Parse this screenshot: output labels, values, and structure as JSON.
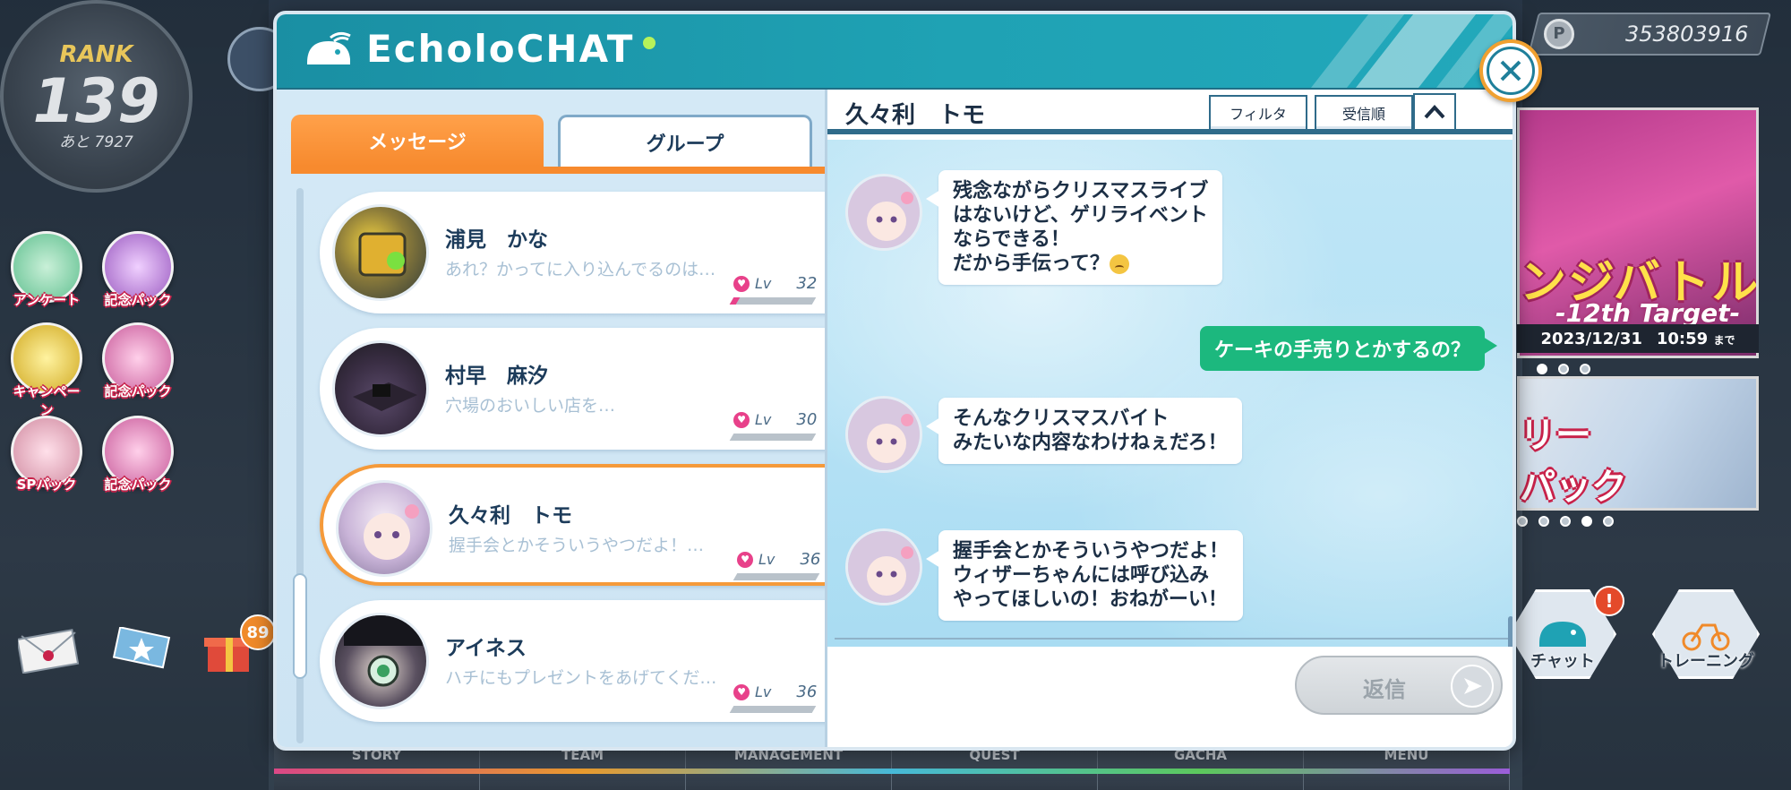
{
  "hud": {
    "rank_label": "RANK",
    "rank_value": "139",
    "rank_next": "あと 7927",
    "currency_symbol": "P",
    "currency_value": "353803916",
    "buttons": [
      {
        "label": "アンケート",
        "color": "#8fd3b0"
      },
      {
        "label": "記念パック",
        "color": "#c77dd8"
      },
      {
        "label": "キャンペーン",
        "color": "#f0d060"
      },
      {
        "label": "記念パック",
        "color": "#e07ab0"
      },
      {
        "label": "SPパック",
        "color": "#f3b0c0"
      },
      {
        "label": "記念パック",
        "color": "#e07ab0"
      }
    ],
    "gift_badge": "89",
    "banner_title": "ンジバトル",
    "banner_sub": "-12th Target-",
    "banner_date": "2023/12/31",
    "banner_time": "10:59",
    "banner_until": "まで",
    "banner2_text": "リー\nパック",
    "side_buttons": [
      {
        "label": "チャット",
        "icon": "whale-icon"
      },
      {
        "label": "トレーニング",
        "icon": "bike-icon"
      }
    ],
    "chat_alert": "!",
    "nav": [
      "STORY",
      "TEAM",
      "MANAGEMENT",
      "QUEST",
      "GACHA",
      "MENU"
    ]
  },
  "dialog": {
    "title": "EcholoCHAT",
    "close_label": "×",
    "tabs": {
      "messages": "メッセージ",
      "groups": "グループ"
    },
    "contacts": [
      {
        "name": "浦見　かな",
        "preview": "あれ？かってに入り込んでるのは…",
        "lv_label": "Lv",
        "lv": "32",
        "lv_fill": 0.05,
        "avatar_color": "#8a7a3a",
        "selected": false
      },
      {
        "name": "村早　麻汐",
        "preview": "穴場のおいしい店を…",
        "lv_label": "Lv",
        "lv": "30",
        "lv_fill": 0.0,
        "avatar_color": "#4a3a5a",
        "selected": false
      },
      {
        "name": "久々利　トモ",
        "preview": "握手会とかそういうやつだよ！…",
        "lv_label": "Lv",
        "lv": "36",
        "lv_fill": 0.0,
        "avatar_color": "#c9b4d8",
        "selected": true
      },
      {
        "name": "アイネス",
        "preview": "ハチにもプレゼントをあげてくだ…",
        "lv_label": "Lv",
        "lv": "36",
        "lv_fill": 0.0,
        "avatar_color": "#2b2b35",
        "selected": false
      }
    ],
    "conversation": {
      "partner_name": "久々利　トモ",
      "filter_label": "フィルタ",
      "sort_label": "受信順",
      "messages": [
        {
          "from": "partner",
          "text": "残念ながらクリスマスライブ\nはないけど、ゲリライベント\nならできる！\nだから手伝って？",
          "emoji": "sweat-smile-emoji"
        },
        {
          "from": "me",
          "text": "ケーキの手売りとかするの？"
        },
        {
          "from": "partner",
          "text": "そんなクリスマスバイト\nみたいな内容なわけねぇだろ！"
        },
        {
          "from": "partner",
          "text": "握手会とかそういうやつだよ！\nウィザーちゃんには呼び込み\nやってほしいの！おねがーい！"
        }
      ],
      "reply_label": "返信"
    }
  },
  "colors": {
    "header_teal": "#1fa2b4",
    "tab_orange": "#f78a2e",
    "outgoing_green": "#1cb87e",
    "chat_bg": "#b6e2f5",
    "close_ring": "#f0a030"
  }
}
